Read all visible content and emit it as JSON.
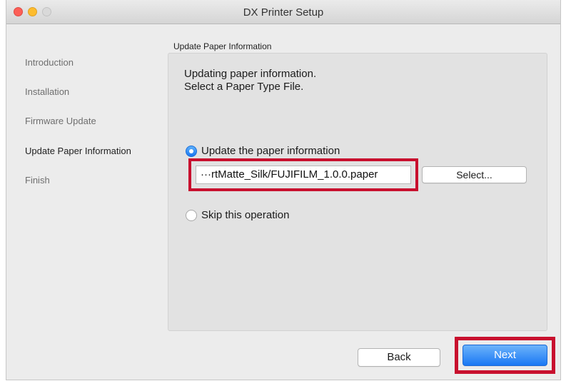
{
  "window": {
    "title": "DX Printer Setup"
  },
  "sidebar": {
    "items": [
      {
        "label": "Introduction",
        "active": false
      },
      {
        "label": "Installation",
        "active": false
      },
      {
        "label": "Firmware Update",
        "active": false
      },
      {
        "label": "Update Paper Information",
        "active": true
      },
      {
        "label": "Finish",
        "active": false
      }
    ]
  },
  "main": {
    "section_title": "Update Paper Information",
    "description_line1": "Updating paper information.",
    "description_line2": "Select a Paper Type File.",
    "option_update": {
      "label": "Update the paper information",
      "selected": true
    },
    "file_path": "···rtMatte_Silk/FUJIFILM_1.0.0.paper",
    "select_button": "Select...",
    "option_skip": {
      "label": "Skip this operation",
      "selected": false
    }
  },
  "footer": {
    "back_button": "Back",
    "next_button": "Next"
  },
  "colors": {
    "highlight": "#c8102e",
    "accent": "#1a78f4"
  }
}
